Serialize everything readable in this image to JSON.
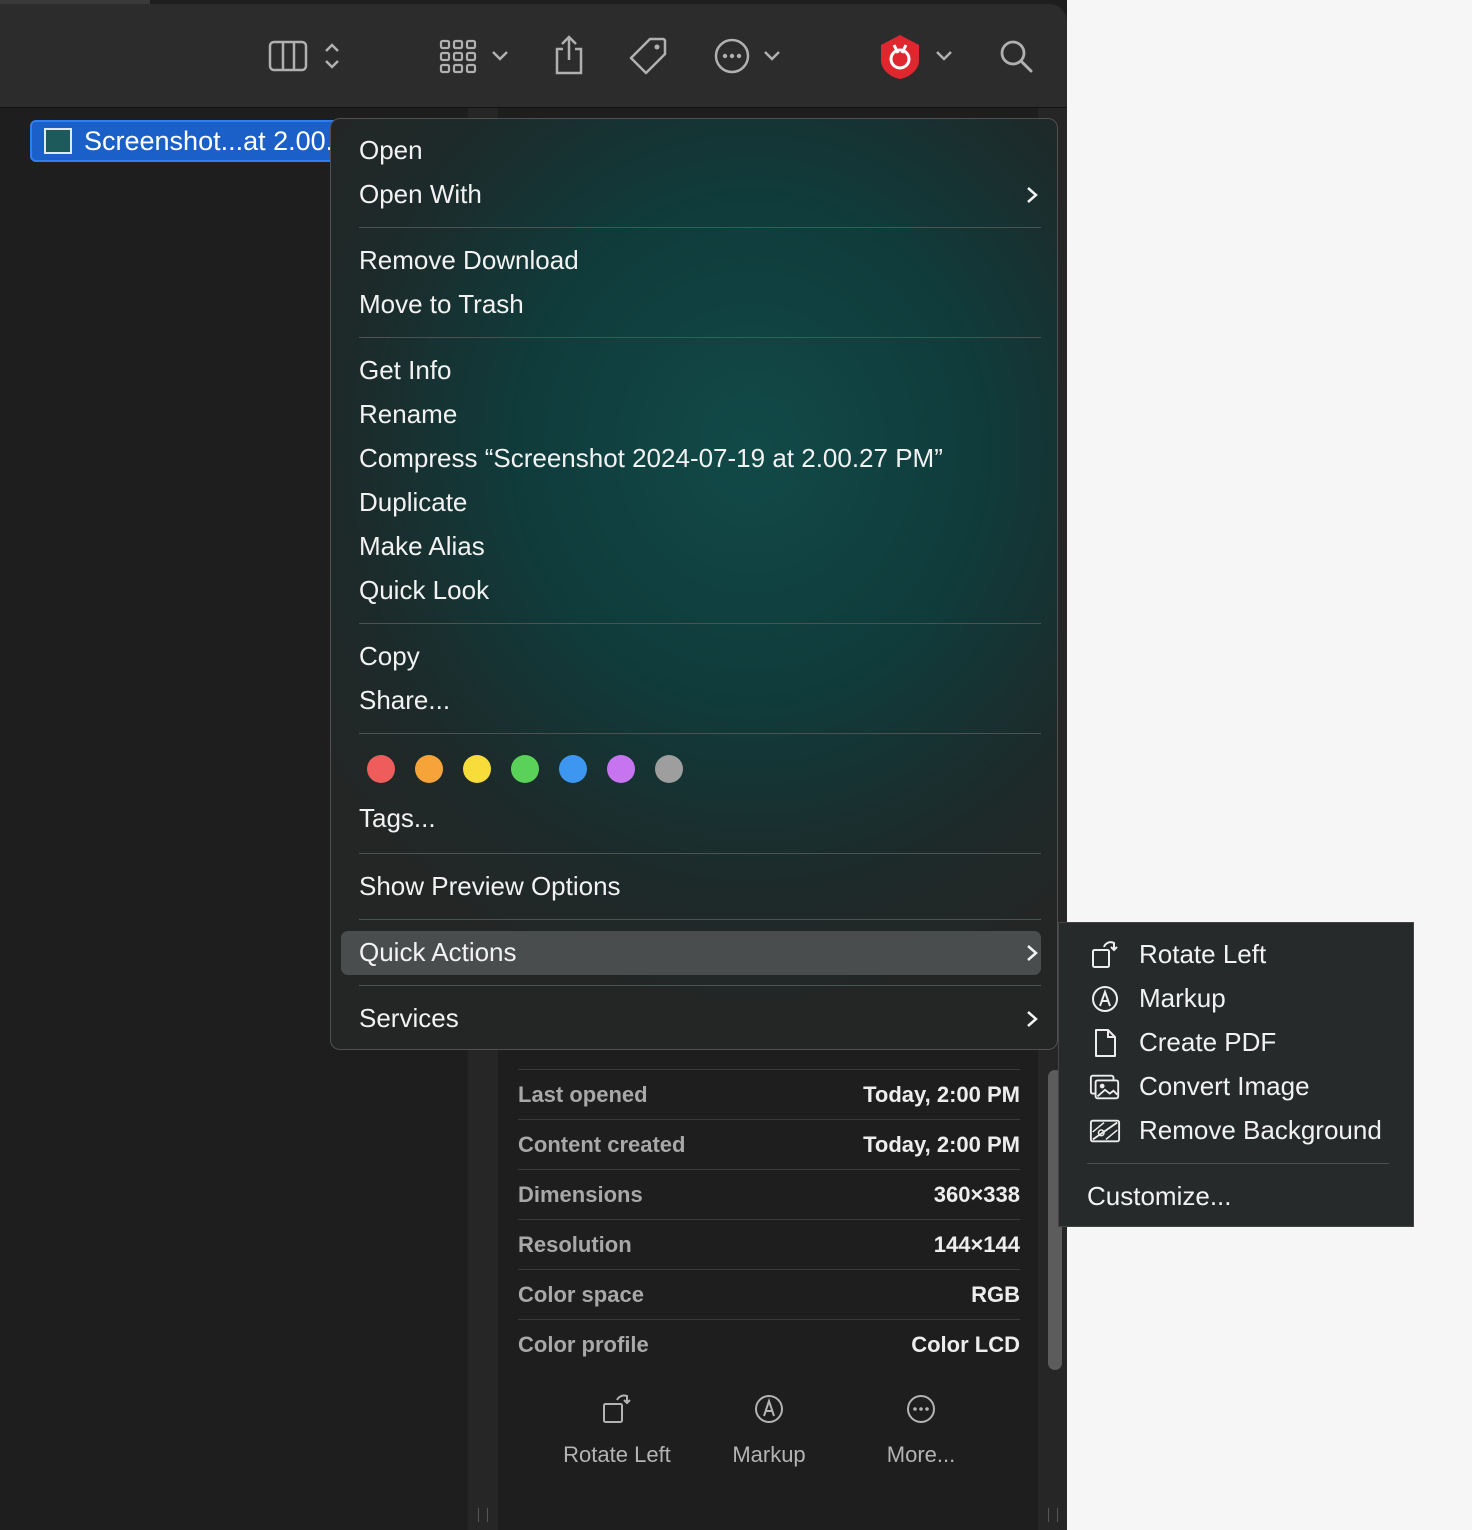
{
  "selected_file": {
    "name": "Screenshot...at 2.00."
  },
  "context_menu": {
    "items": {
      "open": "Open",
      "open_with": "Open With",
      "remove_download": "Remove Download",
      "move_to_trash": "Move to Trash",
      "get_info": "Get Info",
      "rename": "Rename",
      "compress": "Compress “Screenshot 2024-07-19 at 2.00.27 PM”",
      "duplicate": "Duplicate",
      "make_alias": "Make Alias",
      "quick_look": "Quick Look",
      "copy": "Copy",
      "share": "Share...",
      "tags": "Tags...",
      "show_preview_options": "Show Preview Options",
      "quick_actions": "Quick Actions",
      "services": "Services"
    },
    "tag_colors": [
      "#ef5c5c",
      "#f6a43a",
      "#f7dc3a",
      "#5ad25a",
      "#3d97f0",
      "#c774f0",
      "#9e9e9e"
    ]
  },
  "quick_actions_submenu": {
    "items": {
      "rotate_left": "Rotate Left",
      "markup": "Markup",
      "create_pdf": "Create PDF",
      "convert_image": "Convert Image",
      "remove_background": "Remove Background",
      "customize": "Customize..."
    }
  },
  "info_panel": {
    "rows": [
      {
        "key": "Last opened",
        "value": "Today, 2:00 PM"
      },
      {
        "key": "Content created",
        "value": "Today, 2:00 PM"
      },
      {
        "key": "Dimensions",
        "value": "360×338"
      },
      {
        "key": "Resolution",
        "value": "144×144"
      },
      {
        "key": "Color space",
        "value": "RGB"
      },
      {
        "key": "Color profile",
        "value": "Color LCD"
      }
    ],
    "actions": {
      "rotate_left": "Rotate Left",
      "markup": "Markup",
      "more": "More..."
    }
  },
  "colors": {
    "selection": "#1b5fc9",
    "toolbar_bg": "#2c2c2c",
    "menu_tint": "#114a48",
    "extension_icon": "#e0262f"
  },
  "icons": [
    "sidebar-columns-icon",
    "updown-chevron-icon",
    "grid-view-icon",
    "chevron-down-icon",
    "share-icon",
    "tag-icon",
    "more-circle-icon",
    "extension-shield-icon",
    "search-icon"
  ]
}
